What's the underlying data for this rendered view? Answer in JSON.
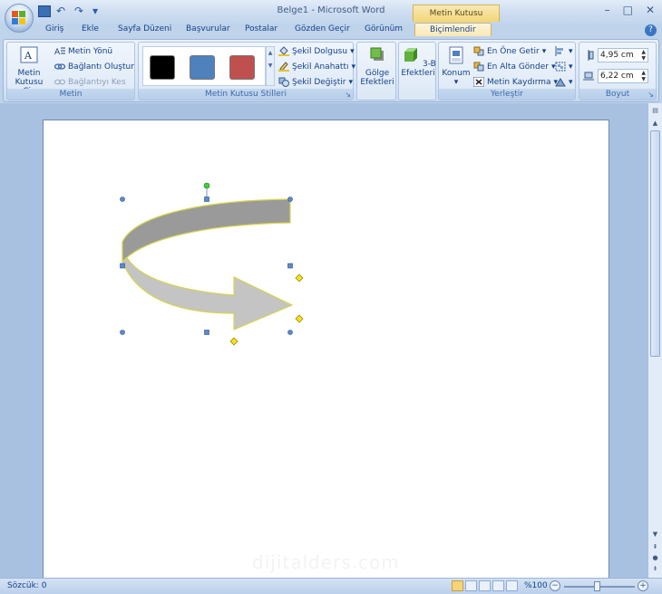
{
  "window": {
    "title": "Belge1 - Microsoft Word",
    "context_tab_title": "Metin Kutusu Araçları",
    "controls": [
      "–",
      "□",
      "✕"
    ]
  },
  "qat": {
    "undo": "↶",
    "redo": "↷",
    "more": "▾"
  },
  "tabs": [
    {
      "label": "Giriş"
    },
    {
      "label": "Ekle"
    },
    {
      "label": "Sayfa Düzeni"
    },
    {
      "label": "Başvurular"
    },
    {
      "label": "Postalar"
    },
    {
      "label": "Gözden Geçir"
    },
    {
      "label": "Görünüm"
    },
    {
      "label": "Biçimlendir"
    }
  ],
  "ribbon": {
    "metin": {
      "label": "Metin",
      "draw_box": "Metin\nKutusu Çiz",
      "text_direction": "Metin Yönü",
      "create_link": "Bağlantı Oluştur",
      "break_link": "Bağlantıyı Kes"
    },
    "styles": {
      "label": "Metin Kutusu Stilleri",
      "swatch_colors": [
        "#000000",
        "#4f81bd",
        "#c0504d"
      ],
      "fill": "Şekil Dolgusu",
      "outline": "Şekil Anahattı",
      "change": "Şekil Değiştir"
    },
    "shadow": {
      "label": "Gölge\nEfektleri"
    },
    "threed": {
      "label": "3-B\nEfektleri"
    },
    "arrange": {
      "label": "Yerleştir",
      "position": "Konum",
      "bring_front": "En Öne Getir",
      "send_back": "En Alta Gönder",
      "wrap": "Metin Kaydırma"
    },
    "size": {
      "label": "Boyut",
      "height": "4,95 cm",
      "width": "6,22 cm"
    }
  },
  "document": {
    "watermark": "dijitalders.com",
    "shape": {
      "fill": "#c4c4c4",
      "outline": "#d8d44a",
      "dark_fill": "#9a9a9a"
    }
  },
  "status": {
    "words": "Sözcük: 0",
    "zoom": "%100"
  }
}
